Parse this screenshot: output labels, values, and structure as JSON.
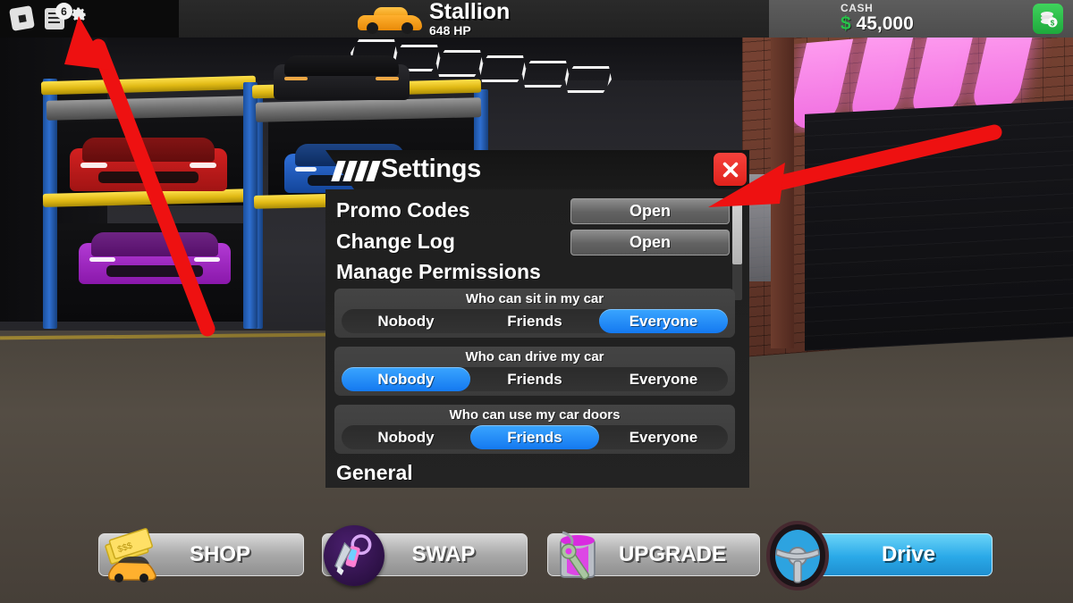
{
  "hud": {
    "roblox_icon": "roblox-logo-icon",
    "chat_icon": "chat-icon",
    "chat_badge": "6",
    "gear_icon": "gear-icon",
    "car_thumb_icon": "orange-car-icon",
    "car_name": "Stallion",
    "car_hp": "648 HP",
    "cash_label": "CASH",
    "cash_currency": "$",
    "cash_amount": "45,000",
    "cash_button_icon": "money-stack-icon"
  },
  "settings_panel": {
    "title": "Settings",
    "logo_icon": "four-stripes-logo-icon",
    "close_icon": "close-x-icon",
    "links": [
      {
        "label": "Promo Codes",
        "button": "Open"
      },
      {
        "label": "Change Log",
        "button": "Open"
      }
    ],
    "sections": [
      {
        "heading": "Manage Permissions"
      },
      {
        "heading": "General"
      }
    ],
    "permissions": [
      {
        "question": "Who can sit in my car",
        "options": [
          "Nobody",
          "Friends",
          "Everyone"
        ],
        "selected": "Everyone"
      },
      {
        "question": "Who can drive my car",
        "options": [
          "Nobody",
          "Friends",
          "Everyone"
        ],
        "selected": "Nobody"
      },
      {
        "question": "Who can use my car doors",
        "options": [
          "Nobody",
          "Friends",
          "Everyone"
        ],
        "selected": "Friends"
      }
    ],
    "scrollbar": "vertical-scrollbar"
  },
  "bottom_bar": {
    "buttons": [
      {
        "label": "SHOP",
        "icon": "money-and-car-icon"
      },
      {
        "label": "SWAP",
        "icon": "car-keys-icon"
      },
      {
        "label": "UPGRADE",
        "icon": "paint-can-wrench-icon"
      },
      {
        "label": "Drive",
        "icon": "steering-wheel-icon"
      }
    ]
  },
  "annotations": {
    "arrow_1": "red-arrow-pointing-to-gear-icon",
    "arrow_2": "red-arrow-pointing-to-promo-codes-open-button"
  },
  "colors": {
    "accent_blue": "#1479f0",
    "drive_blue": "#2aa9e8",
    "cash_green": "#28c24a",
    "close_red": "#e0221c",
    "annotation_red": "#ee1111",
    "panel_bg": "#1f1f1f",
    "card_bg": "#3f3f3f"
  }
}
